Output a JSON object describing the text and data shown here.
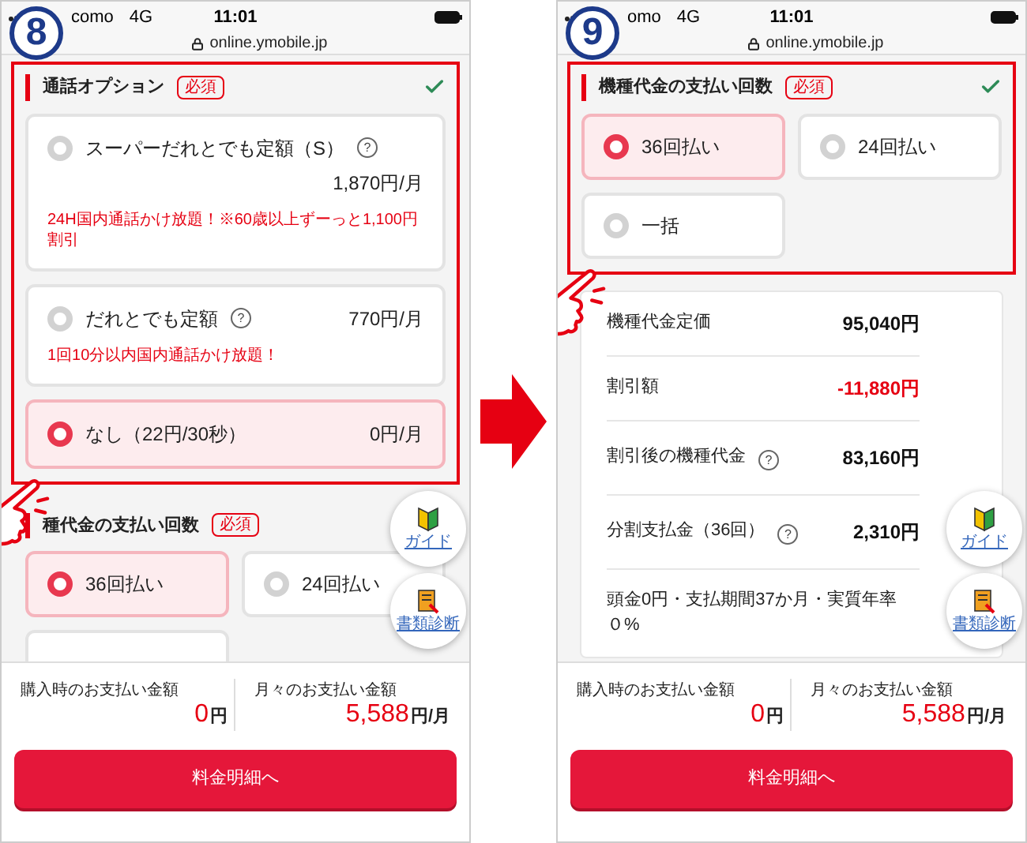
{
  "panels": [
    {
      "step": "8",
      "status": {
        "carrier": "como",
        "network": "4G",
        "time": "11:01"
      },
      "url": "online.ymobile.jp",
      "sections": [
        {
          "title": "通話オプション",
          "badge": "必須",
          "complete": true,
          "highlighted": true,
          "pointer": true,
          "kind": "list",
          "options": [
            {
              "kind": "radio",
              "label": "スーパーだれとでも定額（S）",
              "help": "?",
              "price": "1,870円/月",
              "note": "24H国内通話かけ放題！※60歳以上ずーっと1,100円割引",
              "selected": false
            },
            {
              "kind": "radio",
              "label": "だれとでも定額",
              "help": "?",
              "price": "770円/月",
              "note": "1回10分以内国内通話かけ放題！",
              "selected": false
            },
            {
              "kind": "radio",
              "label": "なし（22円/30秒）",
              "price": "0円/月",
              "selected": true
            }
          ]
        },
        {
          "title": "種代金の支払い回数",
          "badge": "必須",
          "kind": "grid",
          "options": [
            {
              "kind": "radio",
              "label": "36回払い",
              "selected": true
            },
            {
              "kind": "radio",
              "label": "24回払い",
              "selected": false
            },
            {
              "kind": "cut"
            }
          ]
        }
      ],
      "summary": [
        {
          "label": "購入時のお支払い金額",
          "value": "0",
          "unit": "円"
        },
        {
          "label": "月々のお支払い金額",
          "value": "5,588",
          "unit": "円/月"
        }
      ],
      "button": "料金明細へ",
      "guides": [
        {
          "kind": "guide",
          "label": "ガイド"
        },
        {
          "kind": "documents",
          "label": "書類診断"
        }
      ]
    },
    {
      "step": "9",
      "status": {
        "carrier": "omo",
        "network": "4G",
        "time": "11:01"
      },
      "url": "online.ymobile.jp",
      "sections": [
        {
          "title": "機種代金の支払い回数",
          "badge": "必須",
          "complete": true,
          "highlighted": true,
          "pointer": true,
          "kind": "grid",
          "options": [
            {
              "kind": "radio",
              "label": "36回払い",
              "selected": true
            },
            {
              "kind": "radio",
              "label": "24回払い",
              "selected": false
            },
            {
              "kind": "radio",
              "label": "一括",
              "selected": false
            }
          ]
        }
      ],
      "price_rows": [
        {
          "label": "機種代金定価",
          "value": "95,040円",
          "negative": false
        },
        {
          "label": "割引額",
          "value": "-11,880円",
          "negative": true
        },
        {
          "label": "割引後の機種代金",
          "help": "?",
          "value": "83,160円",
          "negative": false
        },
        {
          "label": "分割支払金（36回）",
          "help": "?",
          "value": "2,310円",
          "negative": false
        },
        {
          "label": "頭金0円・支払期間37か月・実質年率０%"
        }
      ],
      "summary": [
        {
          "label": "購入時のお支払い金額",
          "value": "0",
          "unit": "円"
        },
        {
          "label": "月々のお支払い金額",
          "value": "5,588",
          "unit": "円/月"
        }
      ],
      "button": "料金明細へ",
      "guides": [
        {
          "kind": "guide",
          "label": "ガイド"
        },
        {
          "kind": "documents",
          "label": "書類診断"
        }
      ]
    }
  ]
}
